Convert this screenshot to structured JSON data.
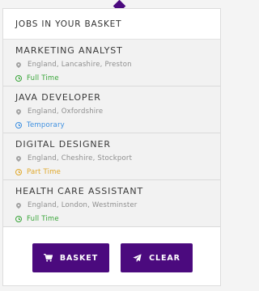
{
  "header": {
    "title": "JOBS IN YOUR BASKET"
  },
  "jobs": [
    {
      "title": "MARKETING ANALYST",
      "location": "England, Lancashire, Preston",
      "type": "Full Time",
      "type_color": "#3aa63a"
    },
    {
      "title": "JAVA DEVELOPER",
      "location": "England, Oxfordshire",
      "type": "Temporary",
      "type_color": "#3d8fe0"
    },
    {
      "title": "DIGITAL DESIGNER",
      "location": "England, Cheshire, Stockport",
      "type": "Part Time",
      "type_color": "#e0a82a"
    },
    {
      "title": "HEALTH CARE ASSISTANT",
      "location": "England, London, Westminster",
      "type": "Full Time",
      "type_color": "#3aa63a"
    }
  ],
  "buttons": {
    "basket_label": "BASKET",
    "clear_label": "CLEAR"
  },
  "icons": {
    "location": "map-marker-icon",
    "job_type": "clock-icon",
    "basket": "shopping-cart-icon",
    "clear": "paper-plane-icon"
  },
  "colors": {
    "accent": "#4b0a7e"
  }
}
